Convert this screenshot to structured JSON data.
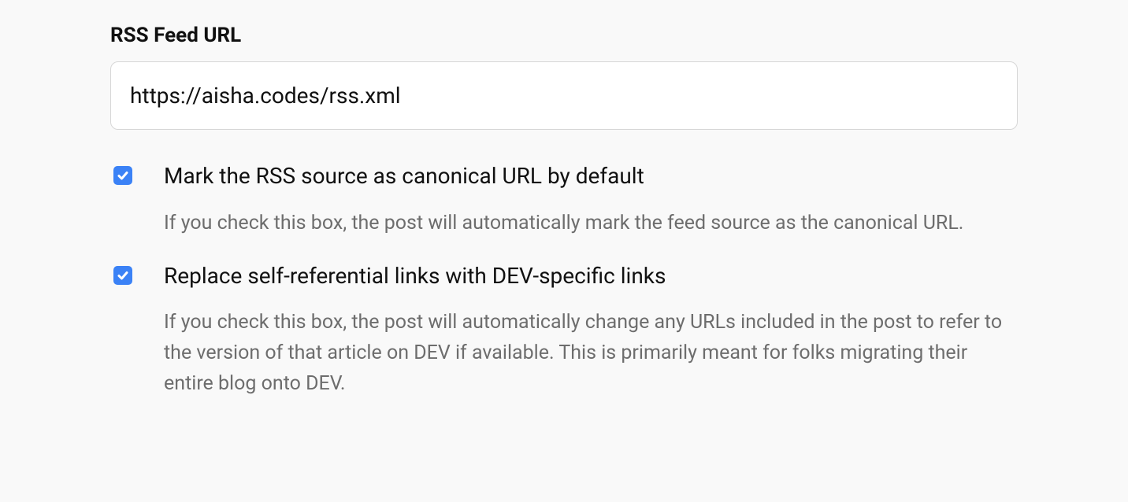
{
  "rss": {
    "label": "RSS Feed URL",
    "value": "https://aisha.codes/rss.xml"
  },
  "options": {
    "canonical": {
      "checked": true,
      "label": "Mark the RSS source as canonical URL by default",
      "description": "If you check this box, the post will automatically mark the feed source as the canonical URL."
    },
    "replace_links": {
      "checked": true,
      "label": "Replace self-referential links with DEV-specific links",
      "description": "If you check this box, the post will automatically change any URLs included in the post to refer to the version of that article on DEV if available. This is primarily meant for folks migrating their entire blog onto DEV."
    }
  }
}
